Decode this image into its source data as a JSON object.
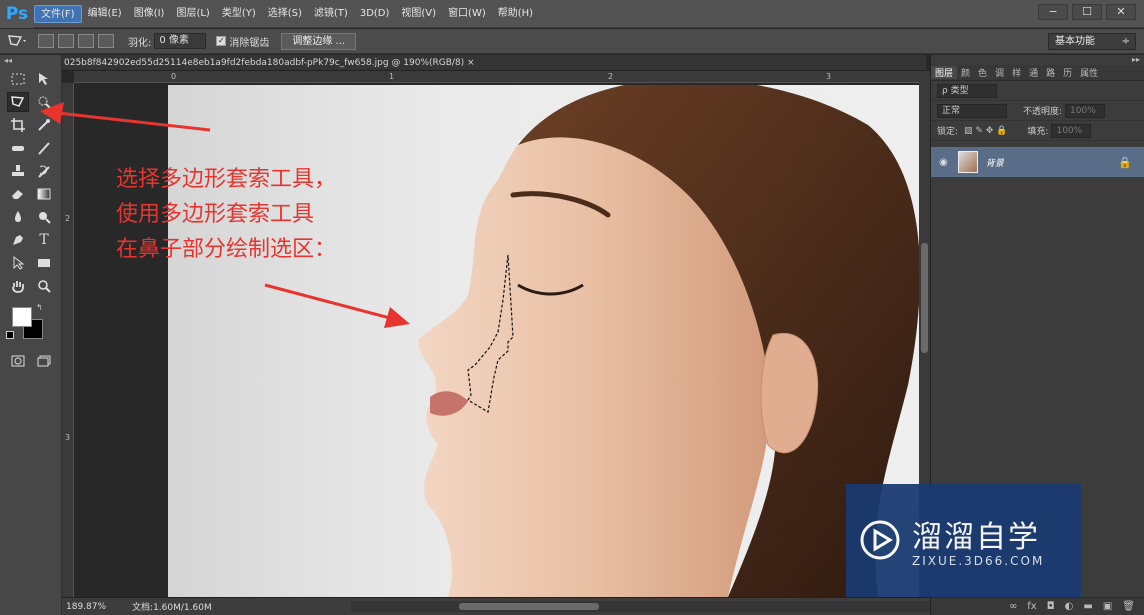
{
  "app": {
    "logo": "Ps"
  },
  "menu": [
    "文件(F)",
    "编辑(E)",
    "图像(I)",
    "图层(L)",
    "类型(Y)",
    "选择(S)",
    "滤镜(T)",
    "3D(D)",
    "视图(V)",
    "窗口(W)",
    "帮助(H)"
  ],
  "window_buttons": [
    "−",
    "☐",
    "✕"
  ],
  "options": {
    "feather_label": "羽化:",
    "feather_value": "0 像素",
    "antialias_label": "消除锯齿",
    "antialias_checked": "✓",
    "refine_edge": "调整边缘 ...",
    "workspace": "基本功能",
    "workspace_arrow": "÷"
  },
  "document": {
    "tab_title": "025b8f842902ed55d25114e8eb1a9fd2febda180adbf-pPk79c_fw658.jpg @ 190%(RGB/8)  ×",
    "ruler_h": [
      "0",
      "1",
      "2",
      "3"
    ],
    "ruler_v": [
      "2",
      "3"
    ]
  },
  "annotation": {
    "lines": [
      "选择多边形套索工具，",
      "使用多边形套索工具",
      "在鼻子部分绘制选区："
    ],
    "color": "#e8342e"
  },
  "status": {
    "zoom": "189.87%",
    "doc_size": "文档:1.60M/1.60M"
  },
  "layers_panel": {
    "tabs": [
      "图层",
      "颜",
      "色",
      "调",
      "样",
      "通",
      "路",
      "历",
      "属性"
    ],
    "filter_label": "ρ 类型",
    "blend_mode": "正常",
    "opacity_label": "不透明度:",
    "opacity_value": "100%",
    "lock_label": "锁定:",
    "fill_label": "填充:",
    "fill_value": "100%",
    "layer_name": "背景"
  },
  "watermark": {
    "title": "溜溜自学",
    "subtitle": "ZIXUE.3D66.COM"
  }
}
